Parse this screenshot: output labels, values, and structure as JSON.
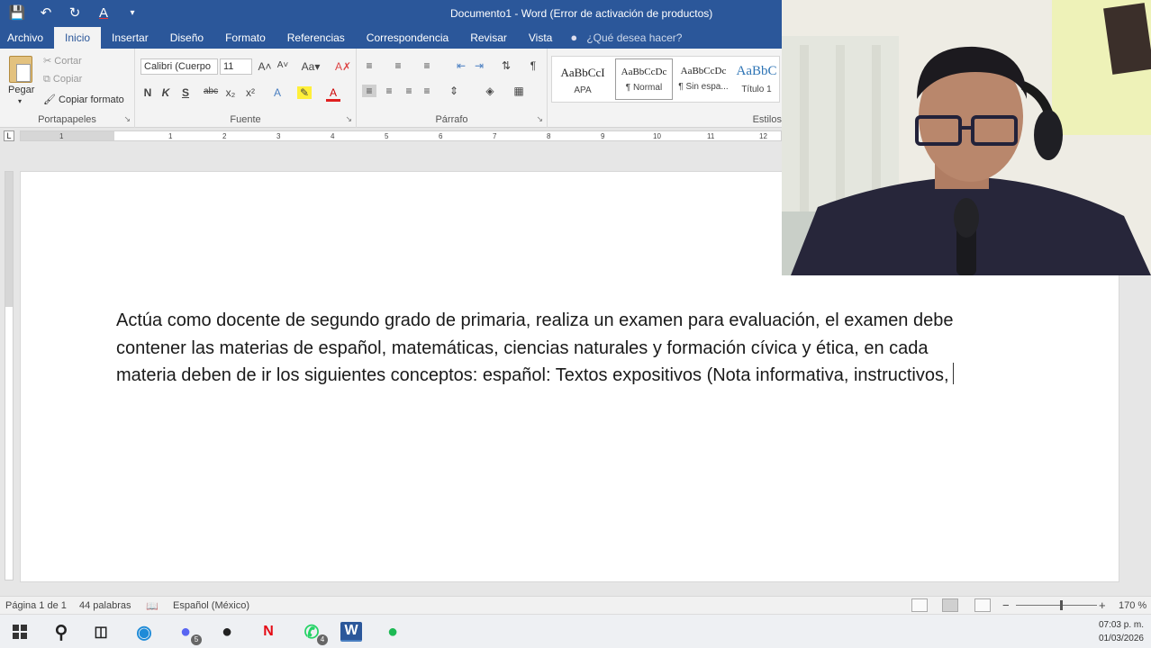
{
  "window": {
    "title": "Documento1 - Word (Error de activación de productos)"
  },
  "quick_access": {
    "icons": [
      "save-icon",
      "undo-icon",
      "redo-icon",
      "font-color-icon",
      "customize-icon"
    ]
  },
  "tabs": [
    {
      "label": "Archivo"
    },
    {
      "label": "Inicio"
    },
    {
      "label": "Insertar"
    },
    {
      "label": "Diseño"
    },
    {
      "label": "Formato"
    },
    {
      "label": "Referencias"
    },
    {
      "label": "Correspondencia"
    },
    {
      "label": "Revisar"
    },
    {
      "label": "Vista"
    },
    {
      "label": "¿Qué desea hacer?"
    }
  ],
  "ribbon": {
    "clipboard": {
      "paste": "Pegar",
      "cut": "Cortar",
      "copy": "Copiar",
      "format_painter": "Copiar formato",
      "label": "Portapapeles"
    },
    "font": {
      "name": "Calibri (Cuerpo",
      "size": "11",
      "label": "Fuente"
    },
    "paragraph": {
      "label": "Párrafo"
    },
    "styles": {
      "label": "Estilos",
      "items": [
        {
          "sample": "AaBbCcI",
          "name": "APA"
        },
        {
          "sample": "AaBbCcDc",
          "name": "¶ Normal"
        },
        {
          "sample": "AaBbCcDc",
          "name": "¶ Sin espa..."
        },
        {
          "sample": "AaBbC",
          "name": "Título 1"
        }
      ]
    }
  },
  "ruler": {
    "numbers": [
      "1",
      "1",
      "2",
      "3",
      "4",
      "5",
      "6",
      "7",
      "8",
      "9",
      "10",
      "11",
      "12"
    ]
  },
  "document": {
    "text": "Actúa como docente de segundo grado de primaria, realiza un examen para evaluación, el examen debe contener las materias de español, matemáticas, ciencias naturales y formación cívica y ética, en cada materia deben de ir los siguientes conceptos: español: Textos expositivos (Nota informativa, instructivos,"
  },
  "status": {
    "page": "Página 1 de 1",
    "words": "44 palabras",
    "language": "Español (México)",
    "zoom": "170 %"
  },
  "taskbar": {
    "time": "07:03 p. m.",
    "date": "01/03/2026",
    "badges": [
      "5",
      "4"
    ]
  }
}
